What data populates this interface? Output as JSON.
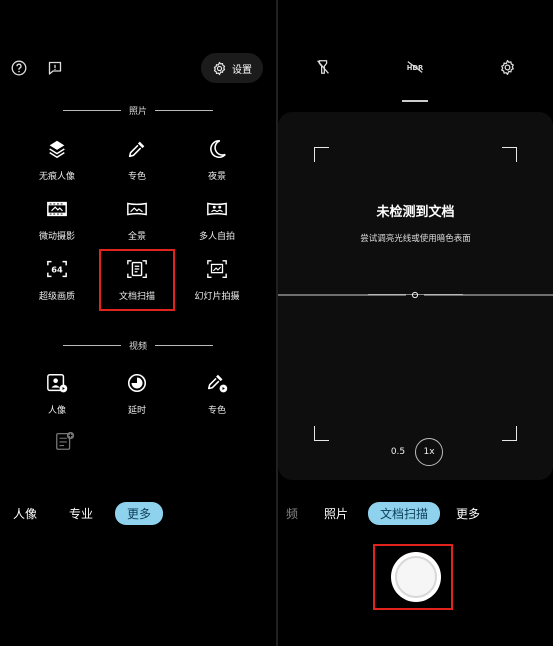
{
  "left": {
    "settings_label": "设置",
    "photo_section": "照片",
    "photo_modes": [
      {
        "label": "无痕人像",
        "icon": "layers-icon"
      },
      {
        "label": "专色",
        "icon": "dropper-icon"
      },
      {
        "label": "夜景",
        "icon": "moon-icon"
      },
      {
        "label": "微动摄影",
        "icon": "film-icon"
      },
      {
        "label": "全景",
        "icon": "panorama-icon"
      },
      {
        "label": "多人自拍",
        "icon": "group-selfie-icon"
      },
      {
        "label": "超级画质",
        "icon": "super-resolution-icon"
      },
      {
        "label": "文档扫描",
        "icon": "document-scan-icon"
      },
      {
        "label": "幻灯片拍摄",
        "icon": "slideshow-icon"
      }
    ],
    "video_section": "视频",
    "video_modes": [
      {
        "label": "人像",
        "icon": "portrait-video-icon"
      },
      {
        "label": "延时",
        "icon": "timelapse-icon"
      },
      {
        "label": "专色",
        "icon": "dropper-video-icon"
      }
    ],
    "mode_bar": {
      "portrait": "人像",
      "pro": "专业",
      "more": "更多"
    }
  },
  "right": {
    "status_title": "未检测到文档",
    "status_hint": "尝试调亮光线或使用暗色表面",
    "zoom_options": [
      "0.5",
      "1x"
    ],
    "mode_bar": {
      "video": "频",
      "photo": "照片",
      "doc_scan": "文档扫描",
      "more": "更多"
    }
  },
  "colors": {
    "accent": "#8fd2ee",
    "highlight_border": "#e0241b"
  }
}
